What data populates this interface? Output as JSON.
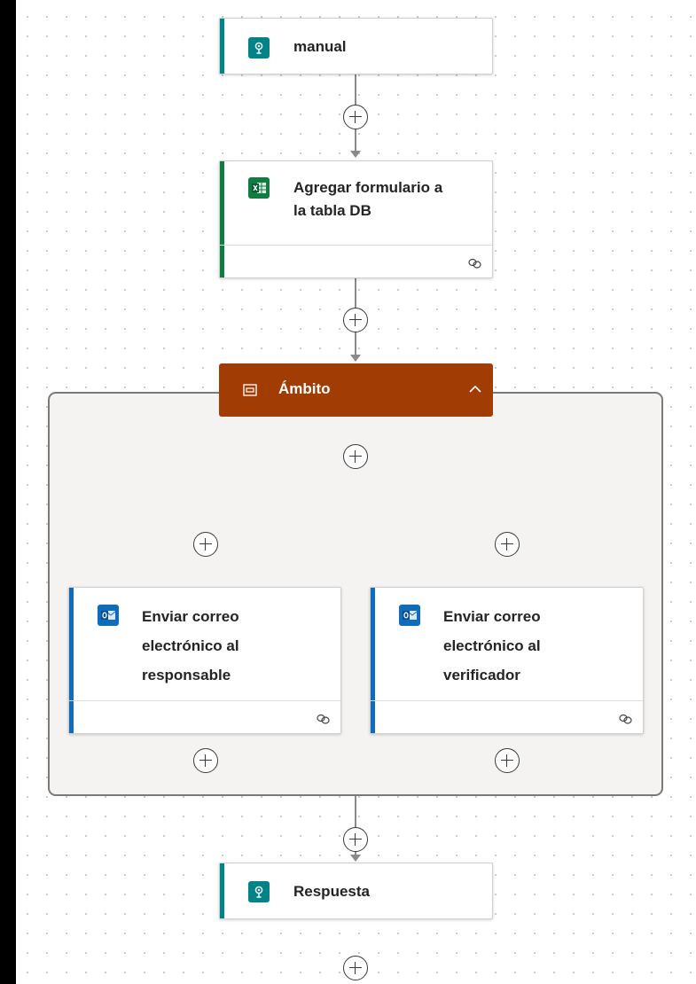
{
  "flow": {
    "trigger": {
      "title": "manual",
      "icon": "request-trigger-icon",
      "accent": "#038387"
    },
    "excel_action": {
      "title_line1": "Agregar formulario a",
      "title_line2": "la tabla DB",
      "icon": "excel-icon",
      "accent": "#107c41"
    },
    "scope": {
      "title": "Ámbito",
      "icon": "scope-icon",
      "accent": "#a13c05",
      "collapse_icon": "chevron-up-icon"
    },
    "email_responsable": {
      "title_line1": "Enviar correo",
      "title_line2": "electrónico al",
      "title_line3": "responsable",
      "icon": "outlook-icon",
      "accent": "#0f6cbd"
    },
    "email_verificador": {
      "title_line1": "Enviar correo",
      "title_line2": "electrónico al",
      "title_line3": "verificador",
      "icon": "outlook-icon",
      "accent": "#0f6cbd"
    },
    "response": {
      "title": "Respuesta",
      "icon": "request-trigger-icon",
      "accent": "#038387"
    }
  }
}
